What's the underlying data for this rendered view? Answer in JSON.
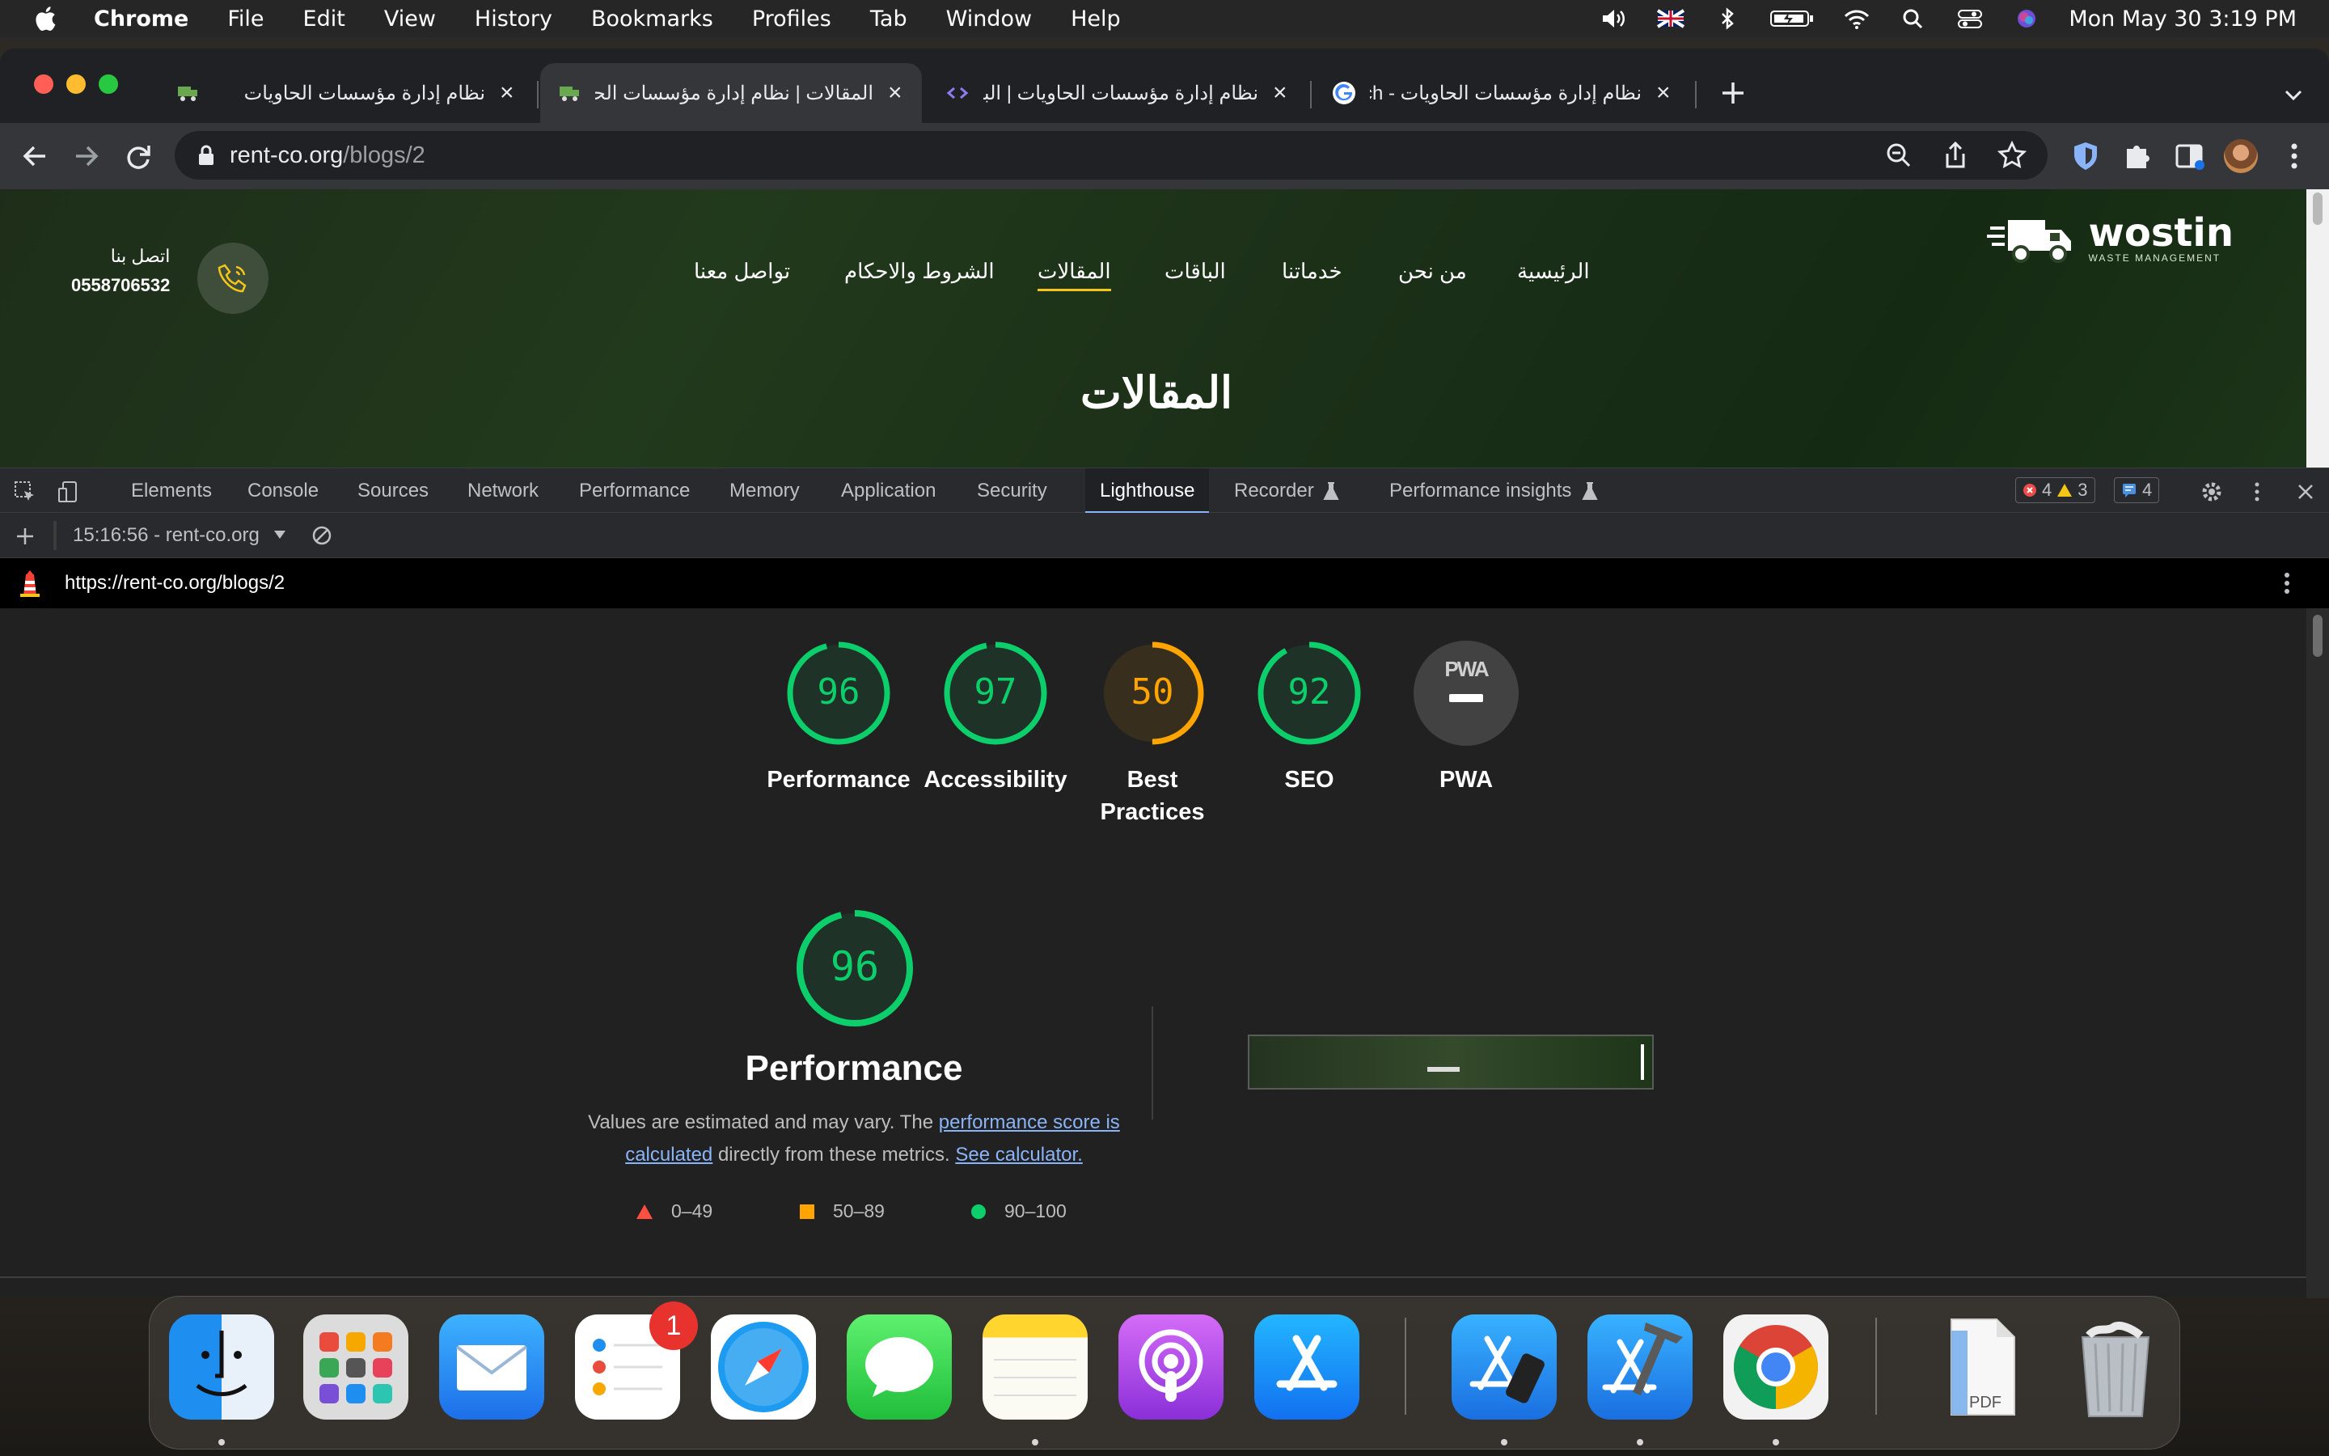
{
  "menubar": {
    "app": "Chrome",
    "items": [
      "File",
      "Edit",
      "View",
      "History",
      "Bookmarks",
      "Profiles",
      "Tab",
      "Window",
      "Help"
    ],
    "clock": "Mon May 30  3:19 PM"
  },
  "tabs": [
    {
      "title": "نظام إدارة مؤسسات الحاويات"
    },
    {
      "title": "المقالات | نظام إدارة مؤسسات الحاو"
    },
    {
      "title": "نظام إدارة مؤسسات الحاويات | الباقا"
    },
    {
      "title": "نظام إدارة مؤسسات الحاويات - arch"
    }
  ],
  "omnibox": {
    "host": "rent-co.org",
    "path": "/blogs/2"
  },
  "site": {
    "logo": "wostin",
    "logo_sub": "WASTE MANAGEMENT",
    "nav": [
      "الرئيسية",
      "من نحن",
      "خدماتنا",
      "الباقات",
      "المقالات",
      "الشروط والاحكام",
      "تواصل معنا"
    ],
    "contact_label": "اتصل بنا",
    "contact_number": "0558706532",
    "title": "المقالات"
  },
  "devtools": {
    "tabs": [
      "Elements",
      "Console",
      "Sources",
      "Network",
      "Performance",
      "Memory",
      "Application",
      "Security",
      "Lighthouse",
      "Recorder",
      "Performance insights"
    ],
    "errors": "4",
    "warnings": "3",
    "messages": "4",
    "report_select": "15:16:56 - rent-co.org",
    "report_url": "https://rent-co.org/blogs/2"
  },
  "lighthouse": {
    "scores": [
      {
        "label": "Performance",
        "value": "96",
        "fraction": 0.96,
        "color": "#0cce6b"
      },
      {
        "label": "Accessibility",
        "value": "97",
        "fraction": 0.97,
        "color": "#0cce6b"
      },
      {
        "label": "Best Practices",
        "value": "50",
        "fraction": 0.5,
        "color": "#ffa400"
      },
      {
        "label": "SEO",
        "value": "92",
        "fraction": 0.92,
        "color": "#0cce6b"
      },
      {
        "label": "PWA",
        "value": "PWA"
      }
    ],
    "perf_score": "96",
    "perf_title": "Performance",
    "desc_before": "Values are estimated and may vary. The ",
    "desc_link1": "performance score is calculated",
    "desc_middle": " directly from these metrics. ",
    "desc_link2": "See calculator.",
    "legend": [
      "0–49",
      "50–89",
      "90–100"
    ],
    "colors": {
      "fail": "#ff4e42",
      "average": "#ffa400",
      "pass": "#0cce6b"
    }
  },
  "dock": {
    "reminders_badge": "1",
    "pdf_label": "PDF"
  }
}
